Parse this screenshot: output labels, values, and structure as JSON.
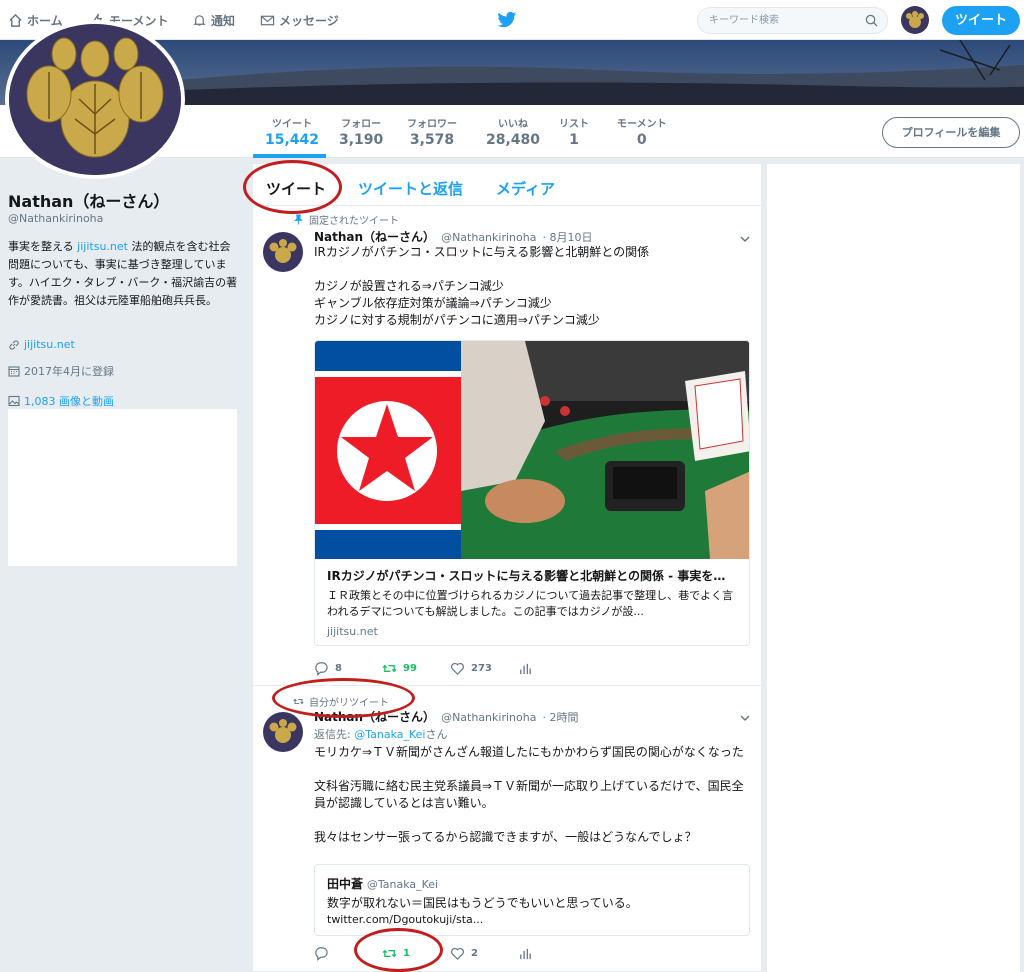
{
  "nav": {
    "home": "ホーム",
    "moments": "モーメント",
    "notifications": "通知",
    "messages": "メッセージ",
    "search_placeholder": "キーワード検索",
    "tweet_button": "ツイート"
  },
  "profile_nav": {
    "stats": [
      {
        "label": "ツイート",
        "value": "15,442"
      },
      {
        "label": "フォロー",
        "value": "3,190"
      },
      {
        "label": "フォロワー",
        "value": "3,578"
      },
      {
        "label": "いいね",
        "value": "28,480"
      },
      {
        "label": "リスト",
        "value": "1"
      },
      {
        "label": "モーメント",
        "value": "0"
      }
    ],
    "edit_profile": "プロフィールを編集"
  },
  "profile": {
    "name": "Nathan（ねーさん）",
    "handle": "@Nathankirinoha",
    "bio_pre": "事実を整える",
    "bio_link": "jijitsu.net",
    "bio_post": "法的観点を含む社会問題についても、事実に基づき整理しています。ハイエク・タレブ・バーク・福沢諭吉の著作が愛読書。祖父は元陸軍船舶砲兵兵長。",
    "website": "jijitsu.net",
    "joined": "2017年4月に登録",
    "media": "1,083 画像と動画"
  },
  "tabs": [
    "ツイート",
    "ツイートと返信",
    "メディア"
  ],
  "tweets": [
    {
      "context": "固定されたツイート",
      "name": "Nathan（ねーさん）",
      "handle": "@Nathankirinoha",
      "time": "· 8月10日",
      "lines": [
        "IRカジノがパチンコ・スロットに与える影響と北朝鮮との関係",
        "",
        "カジノが設置される⇒パチンコ減少",
        "ギャンブル依存症対策が議論⇒パチンコ減少",
        "カジノに対する規制がパチンコに適用⇒パチンコ減少"
      ],
      "card": {
        "title": "IRカジノがパチンコ・スロットに与える影響と北朝鮮との関係 - 事実を整...",
        "desc": "ＩＲ政策とその中に位置づけられるカジノについて過去記事で整理し、巷でよく言われるデマについても解説しました。この記事ではカジノが設...",
        "domain": "jijitsu.net"
      },
      "replies": "8",
      "retweets": "99",
      "likes": "273"
    },
    {
      "context": "自分がリツイート",
      "name": "Nathan（ねーさん）",
      "handle": "@Nathankirinoha",
      "time": "· 2時間",
      "reply_to_label": "返信先:",
      "reply_to_handle": "@Tanaka_Kei",
      "reply_to_suffix": "さん",
      "lines": [
        "モリカケ⇒ＴＶ新聞がさんざん報道したにもかかわらず国民の関心がなくなった",
        "",
        "文科省汚職に絡む民主党系議員⇒ＴＶ新聞が一応取り上げているだけで、国民全員が認識しているとは言い難い。",
        "",
        "我々はセンサー張ってるから認識できますが、一般はどうなんでしょ？"
      ],
      "quote": {
        "name": "田中蒼",
        "handle": "@Tanaka_Kei",
        "text": "数字が取れない＝国民はもうどうでもいいと思っている。",
        "link": "twitter.com/Dgoutokuji/sta..."
      },
      "replies": "",
      "retweets": "1",
      "likes": "2"
    }
  ],
  "colors": {
    "accent": "#1da1f2",
    "retweet": "#17bf63",
    "annotation": "#c21e1e"
  }
}
